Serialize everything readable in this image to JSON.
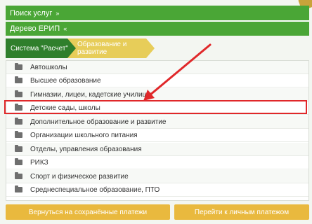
{
  "search_services": {
    "label": "Поиск услуг",
    "chevron": "»"
  },
  "erip_tree": {
    "label": "Дерево ЕРИП",
    "chevron": "«"
  },
  "breadcrumb": {
    "items": [
      {
        "label": "Система \"Расчет\""
      },
      {
        "label": "Образование и развитие"
      }
    ]
  },
  "categories": [
    {
      "label": "Автошколы"
    },
    {
      "label": "Высшее образование"
    },
    {
      "label": "Гимназии, лицеи, кадетские училища"
    },
    {
      "label": "Детские сады, школы"
    },
    {
      "label": "Дополнительное образование и развитие"
    },
    {
      "label": "Организации школьного питания"
    },
    {
      "label": "Отделы, управления образования"
    },
    {
      "label": "РИКЗ"
    },
    {
      "label": "Спорт и физическое развитие"
    },
    {
      "label": "Среднеспециальное образование, ПТО"
    }
  ],
  "buttons": {
    "saved_payments": "Вернуться на сохранённые платежи",
    "personal_payments": "Перейти к личным платежом"
  },
  "colors": {
    "green": "#4aa636",
    "dark_green": "#2f7f2c",
    "yellow": "#e7cd59",
    "button_yellow": "#e9b93e",
    "highlight_red": "#e0282a"
  },
  "icons": [
    "folder-icon",
    "arrow-annotation-icon"
  ]
}
